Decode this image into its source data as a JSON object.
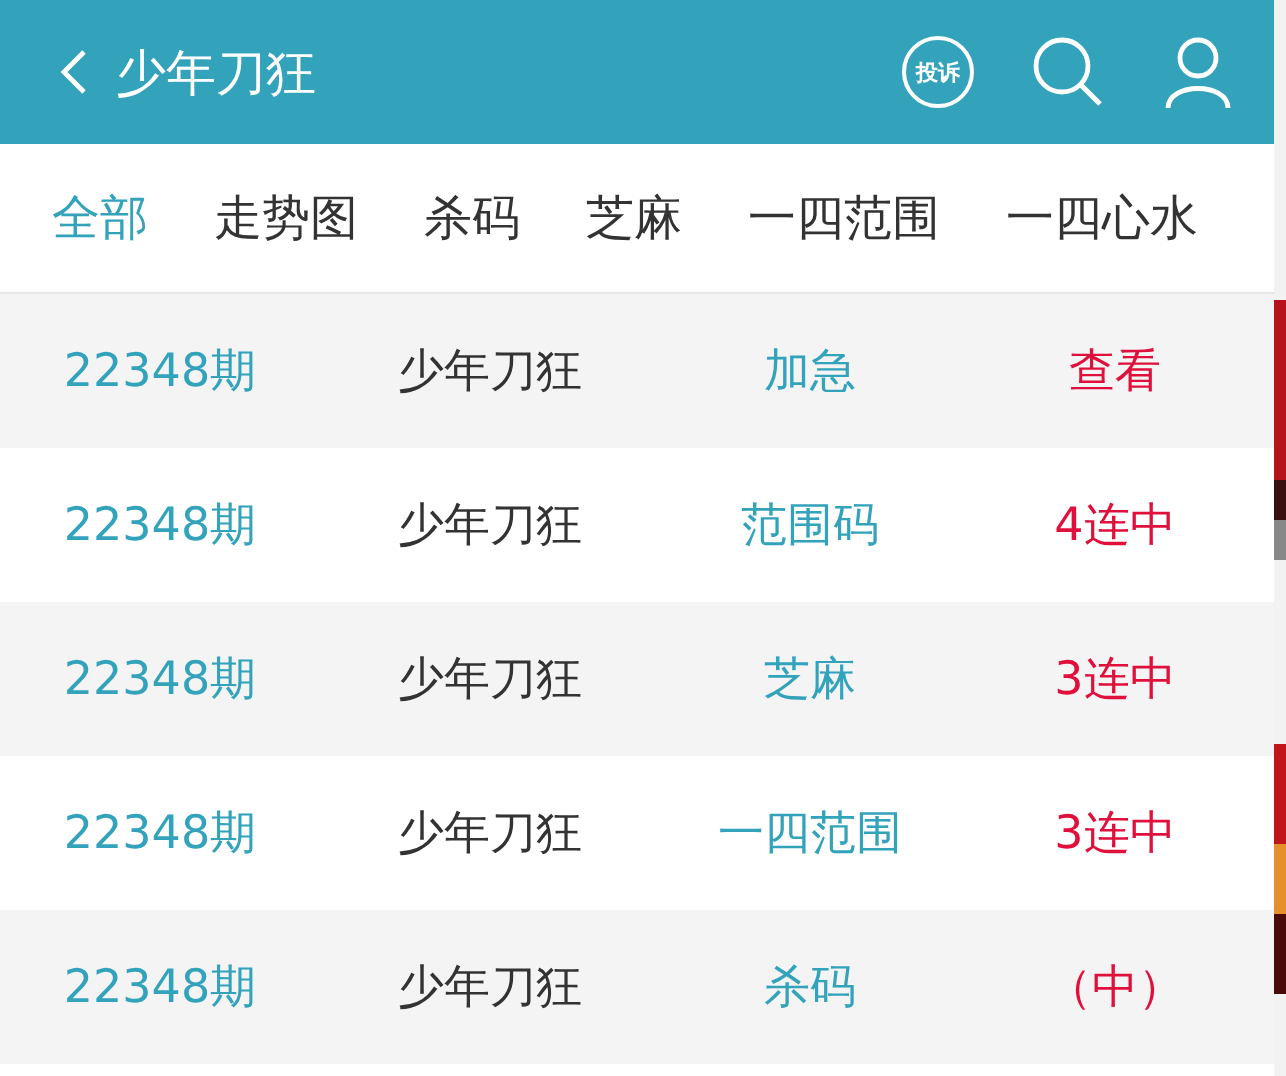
{
  "header": {
    "title": "少年刀狂",
    "complaint_badge": "投诉"
  },
  "tabs": [
    {
      "label": "全部",
      "selected": true
    },
    {
      "label": "走势图",
      "selected": false
    },
    {
      "label": "杀码",
      "selected": false
    },
    {
      "label": "芝麻",
      "selected": false
    },
    {
      "label": "一四范围",
      "selected": false
    },
    {
      "label": "一四心水",
      "selected": false
    }
  ],
  "rows": [
    {
      "period": "22348期",
      "author": "少年刀狂",
      "category": "加急",
      "result": "查看"
    },
    {
      "period": "22348期",
      "author": "少年刀狂",
      "category": "范围码",
      "result": "4连中"
    },
    {
      "period": "22348期",
      "author": "少年刀狂",
      "category": "芝麻",
      "result": "3连中"
    },
    {
      "period": "22348期",
      "author": "少年刀狂",
      "category": "一四范围",
      "result": "3连中"
    },
    {
      "period": "22348期",
      "author": "少年刀狂",
      "category": "杀码",
      "result": "（中）"
    }
  ]
}
